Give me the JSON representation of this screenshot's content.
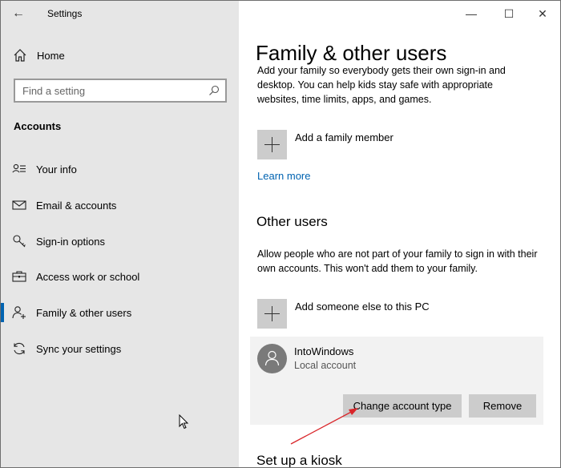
{
  "window": {
    "app_title": "Settings",
    "back_glyph": "←",
    "minimize_glyph": "—",
    "maximize_glyph": "☐",
    "close_glyph": "✕"
  },
  "sidebar": {
    "home_label": "Home",
    "search_placeholder": "Find a setting",
    "section_label": "Accounts",
    "items": [
      {
        "label": "Your info",
        "icon": "person-list-icon"
      },
      {
        "label": "Email & accounts",
        "icon": "envelope-icon"
      },
      {
        "label": "Sign-in options",
        "icon": "key-icon"
      },
      {
        "label": "Access work or school",
        "icon": "briefcase-icon"
      },
      {
        "label": "Family & other users",
        "icon": "person-add-icon",
        "active": true
      },
      {
        "label": "Sync your settings",
        "icon": "sync-icon"
      }
    ]
  },
  "main": {
    "title": "Family & other users",
    "family_desc": "Add your family so everybody gets their own sign-in and desktop. You can help kids stay safe with appropriate websites, time limits, apps, and games.",
    "add_family_label": "Add a family member",
    "learn_more": "Learn more",
    "other_users_heading": "Other users",
    "other_users_desc": "Allow people who are not part of your family to sign in with their own accounts. This won't add them to your family.",
    "add_other_label": "Add someone else to this PC",
    "user": {
      "name": "IntoWindows",
      "type": "Local account",
      "change_button": "Change account type",
      "remove_button": "Remove"
    },
    "kiosk_heading": "Set up a kiosk"
  },
  "colors": {
    "accent": "#0063b1",
    "annotation_arrow": "#d9262a"
  }
}
